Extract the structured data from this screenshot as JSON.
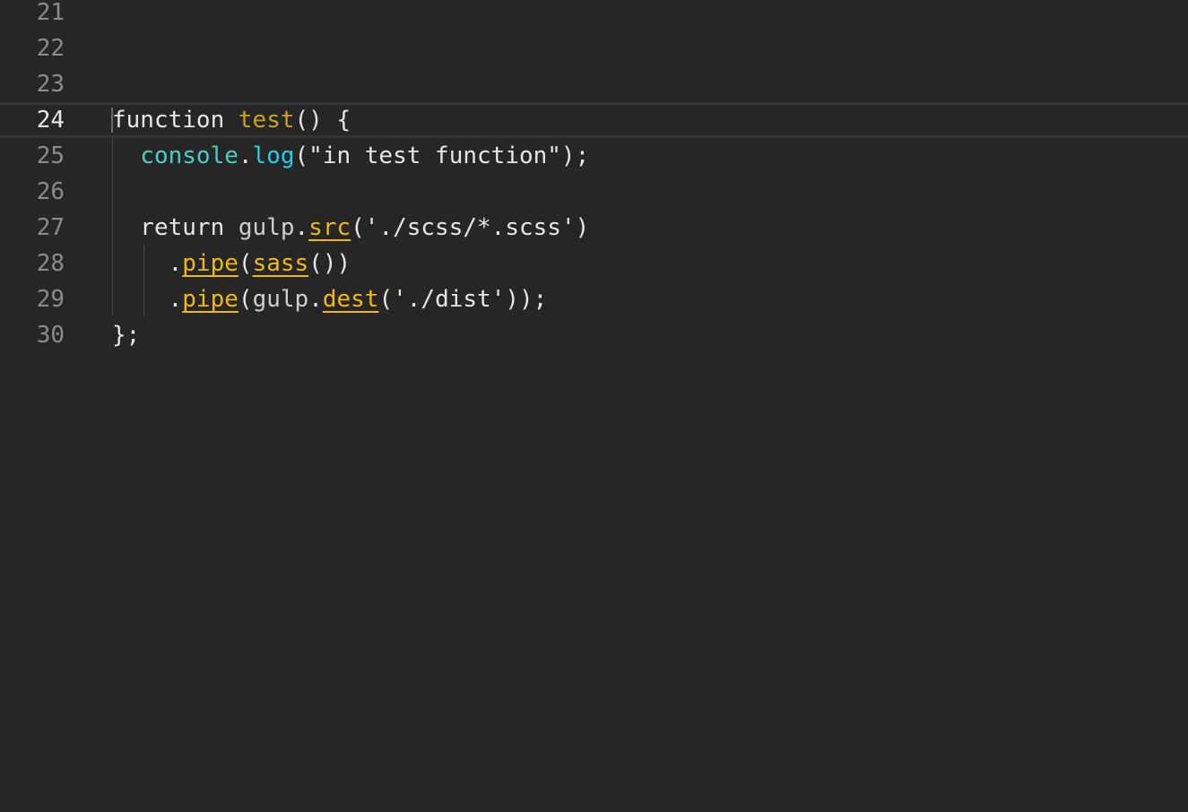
{
  "editor": {
    "lines": [
      {
        "number": "21",
        "current": false,
        "tokens": []
      },
      {
        "number": "22",
        "current": false,
        "tokens": []
      },
      {
        "number": "23",
        "current": false,
        "tokens": []
      },
      {
        "number": "24",
        "current": true,
        "tokens": [
          {
            "text": "function ",
            "kind": "plain"
          },
          {
            "text": "test",
            "kind": "fn-name"
          },
          {
            "text": "() {",
            "kind": "plain"
          }
        ]
      },
      {
        "number": "25",
        "current": false,
        "tokens": [
          {
            "text": "  ",
            "kind": "plain"
          },
          {
            "text": "console",
            "kind": "builtin"
          },
          {
            "text": ".",
            "kind": "plain"
          },
          {
            "text": "log",
            "kind": "method-cyan"
          },
          {
            "text": "(\"in test function\");",
            "kind": "plain"
          }
        ]
      },
      {
        "number": "26",
        "current": false,
        "tokens": []
      },
      {
        "number": "27",
        "current": false,
        "tokens": [
          {
            "text": "  return ",
            "kind": "plain"
          },
          {
            "text": "gulp",
            "kind": "ident"
          },
          {
            "text": ".",
            "kind": "plain"
          },
          {
            "text": "src",
            "kind": "method-warn"
          },
          {
            "text": "('./scss/*.scss')",
            "kind": "plain"
          }
        ]
      },
      {
        "number": "28",
        "current": false,
        "tokens": [
          {
            "text": "    .",
            "kind": "plain"
          },
          {
            "text": "pipe",
            "kind": "method-warn"
          },
          {
            "text": "(",
            "kind": "plain"
          },
          {
            "text": "sass",
            "kind": "method-warn"
          },
          {
            "text": "())",
            "kind": "plain"
          }
        ]
      },
      {
        "number": "29",
        "current": false,
        "tokens": [
          {
            "text": "    .",
            "kind": "plain"
          },
          {
            "text": "pipe",
            "kind": "method-warn"
          },
          {
            "text": "(",
            "kind": "plain"
          },
          {
            "text": "gulp",
            "kind": "ident"
          },
          {
            "text": ".",
            "kind": "plain"
          },
          {
            "text": "dest",
            "kind": "method-warn"
          },
          {
            "text": "('./dist'));",
            "kind": "plain"
          }
        ]
      },
      {
        "number": "30",
        "current": false,
        "tokens": [
          {
            "text": "};",
            "kind": "plain"
          }
        ]
      }
    ]
  }
}
